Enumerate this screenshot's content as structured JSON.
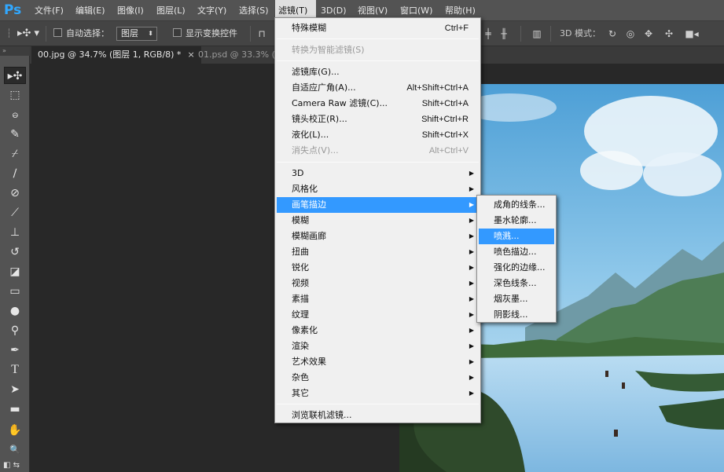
{
  "app": {
    "logo": "Ps",
    "logo_color": "#31a8ff"
  },
  "menubar": {
    "items": [
      {
        "label": "文件(F)"
      },
      {
        "label": "编辑(E)"
      },
      {
        "label": "图像(I)"
      },
      {
        "label": "图层(L)"
      },
      {
        "label": "文字(Y)"
      },
      {
        "label": "选择(S)"
      },
      {
        "label": "滤镜(T)",
        "active": true
      },
      {
        "label": "3D(D)"
      },
      {
        "label": "视图(V)"
      },
      {
        "label": "窗口(W)"
      },
      {
        "label": "帮助(H)"
      }
    ]
  },
  "options_bar": {
    "auto_select_label": "自动选择：",
    "auto_select_value": "图层",
    "show_transform_label": "显示变换控件",
    "mode_3d_label": "3D 模式："
  },
  "tabs": [
    {
      "label": "00.jpg @ 34.7% (图层 1, RGB/8) *",
      "close": "×",
      "active": true
    },
    {
      "label": "01.psd @ 33.3% (",
      "active": false
    }
  ],
  "filter_menu": {
    "items": [
      {
        "label": "特殊模糊",
        "shortcut": "Ctrl+F"
      },
      {
        "separator": true
      },
      {
        "label": "转换为智能滤镜(S)",
        "disabled": true
      },
      {
        "separator": true
      },
      {
        "label": "滤镜库(G)..."
      },
      {
        "label": "自适应广角(A)...",
        "shortcut": "Alt+Shift+Ctrl+A"
      },
      {
        "label": "Camera Raw 滤镜(C)...",
        "shortcut": "Shift+Ctrl+A"
      },
      {
        "label": "镜头校正(R)...",
        "shortcut": "Shift+Ctrl+R"
      },
      {
        "label": "液化(L)...",
        "shortcut": "Shift+Ctrl+X"
      },
      {
        "label": "消失点(V)...",
        "shortcut": "Alt+Ctrl+V",
        "disabled": true
      },
      {
        "separator": true
      },
      {
        "label": "3D",
        "submenu": true
      },
      {
        "label": "风格化",
        "submenu": true
      },
      {
        "label": "画笔描边",
        "submenu": true,
        "highlighted": true
      },
      {
        "label": "模糊",
        "submenu": true
      },
      {
        "label": "模糊画廊",
        "submenu": true
      },
      {
        "label": "扭曲",
        "submenu": true
      },
      {
        "label": "锐化",
        "submenu": true
      },
      {
        "label": "视频",
        "submenu": true
      },
      {
        "label": "素描",
        "submenu": true
      },
      {
        "label": "纹理",
        "submenu": true
      },
      {
        "label": "像素化",
        "submenu": true
      },
      {
        "label": "渲染",
        "submenu": true
      },
      {
        "label": "艺术效果",
        "submenu": true
      },
      {
        "label": "杂色",
        "submenu": true
      },
      {
        "label": "其它",
        "submenu": true
      },
      {
        "separator": true
      },
      {
        "label": "浏览联机滤镜..."
      }
    ]
  },
  "brush_strokes_submenu": {
    "items": [
      {
        "label": "成角的线条..."
      },
      {
        "label": "墨水轮廓..."
      },
      {
        "label": "喷溅...",
        "highlighted": true
      },
      {
        "label": "喷色描边..."
      },
      {
        "label": "强化的边缘..."
      },
      {
        "label": "深色线条..."
      },
      {
        "label": "烟灰墨..."
      },
      {
        "label": "阴影线..."
      }
    ]
  },
  "tools": [
    {
      "name": "move-tool",
      "glyph": "▸✣"
    },
    {
      "name": "marquee-tool",
      "glyph": "⬚"
    },
    {
      "name": "lasso-tool",
      "glyph": "ဓ"
    },
    {
      "name": "quick-select-tool",
      "glyph": "✎"
    },
    {
      "name": "crop-tool",
      "glyph": "⌿"
    },
    {
      "name": "eyedropper-tool",
      "glyph": "∕"
    },
    {
      "name": "healing-brush-tool",
      "glyph": "⊘"
    },
    {
      "name": "brush-tool",
      "glyph": "⟋"
    },
    {
      "name": "clone-stamp-tool",
      "glyph": "⊥"
    },
    {
      "name": "history-brush-tool",
      "glyph": "↺"
    },
    {
      "name": "eraser-tool",
      "glyph": "◪"
    },
    {
      "name": "gradient-tool",
      "glyph": "▭"
    },
    {
      "name": "blur-tool",
      "glyph": "●"
    },
    {
      "name": "dodge-tool",
      "glyph": "⚲"
    },
    {
      "name": "pen-tool",
      "glyph": "✒"
    },
    {
      "name": "type-tool",
      "glyph": "T"
    },
    {
      "name": "path-select-tool",
      "glyph": "➤"
    },
    {
      "name": "shape-tool",
      "glyph": "▬"
    },
    {
      "name": "hand-tool",
      "glyph": "✋"
    },
    {
      "name": "zoom-tool",
      "glyph": "🔍"
    }
  ]
}
